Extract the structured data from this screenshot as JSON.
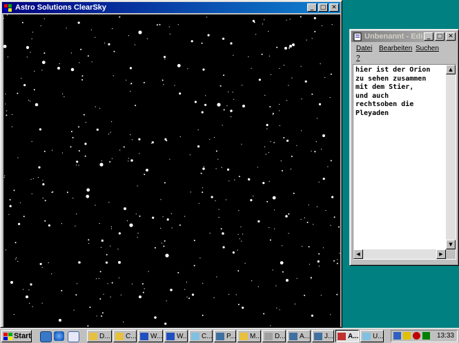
{
  "windows": {
    "clearsky": {
      "title": "Astro Solutions ClearSky",
      "controls": {
        "minimize": "_",
        "maximize": "□",
        "close": "✕"
      }
    },
    "editor": {
      "title": "Unbenannt - Editor",
      "controls": {
        "minimize": "_",
        "maximize": "□",
        "close": "✕"
      },
      "menu": [
        "Datei",
        "Bearbeiten",
        "Suchen",
        "?"
      ],
      "text": "hier ist der Orion\nzu sehen zusammen\nmit dem Stier,\nund auch\nrechtsoben die\nPleyaden"
    }
  },
  "taskbar": {
    "start_label": "Start",
    "quick_launch": [
      "desktop-icon",
      "internet-explorer-icon",
      "outlook-icon"
    ],
    "buttons": [
      {
        "label": "D...",
        "icon": "folder-icon",
        "active": false
      },
      {
        "label": "C...",
        "icon": "folder-icon",
        "active": false
      },
      {
        "label": "W...",
        "icon": "word-icon",
        "active": false
      },
      {
        "label": "W...",
        "icon": "word-icon",
        "active": false
      },
      {
        "label": "C...",
        "icon": "notepad-icon",
        "active": false
      },
      {
        "label": "P...",
        "icon": "program-icon",
        "active": false
      },
      {
        "label": "M...",
        "icon": "folder-icon",
        "active": false
      },
      {
        "label": "D...",
        "icon": "calendar-icon",
        "active": false
      },
      {
        "label": "A...",
        "icon": "program-icon",
        "active": false
      },
      {
        "label": "J...",
        "icon": "program-icon",
        "active": false
      },
      {
        "label": "A...",
        "icon": "clearsky-icon",
        "active": true
      },
      {
        "label": "U...",
        "icon": "notepad-icon",
        "active": false
      }
    ],
    "clock": "13:33"
  }
}
